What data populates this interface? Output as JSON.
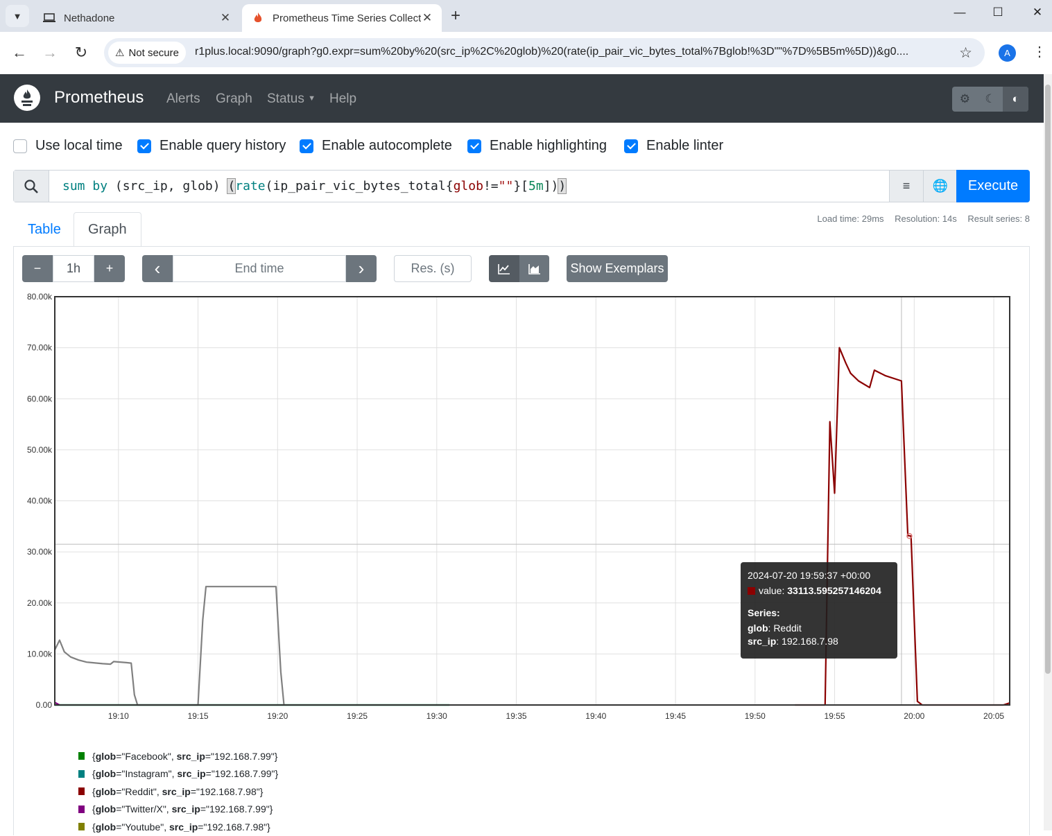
{
  "browser": {
    "tabs": [
      {
        "title": "Nethadone",
        "active": false
      },
      {
        "title": "Prometheus Time Series Collect",
        "active": true
      }
    ],
    "new_tab": "+",
    "window_controls": {
      "minimize": "—",
      "maximize": "☐",
      "close": "✕"
    },
    "security_label": "Not secure",
    "url": "r1plus.local:9090/graph?g0.expr=sum%20by%20(src_ip%2C%20glob)%20(rate(ip_pair_vic_bytes_total%7Bglob!%3D\"\"%7D%5B5m%5D))&g0....",
    "profile_initial": "A"
  },
  "navbar": {
    "brand": "Prometheus",
    "links": [
      "Alerts",
      "Graph",
      "Status",
      "Help"
    ]
  },
  "options": [
    {
      "label": "Use local time",
      "checked": false
    },
    {
      "label": "Enable query history",
      "checked": true
    },
    {
      "label": "Enable autocomplete",
      "checked": true
    },
    {
      "label": "Enable highlighting",
      "checked": true
    },
    {
      "label": "Enable linter",
      "checked": true
    }
  ],
  "query": {
    "expression": "sum by (src_ip, glob) (rate(ip_pair_vic_bytes_total{glob!=\"\"}[5m]))",
    "execute_label": "Execute"
  },
  "tabs": {
    "table": "Table",
    "graph": "Graph"
  },
  "stats": {
    "load_time": "Load time: 29ms",
    "resolution": "Resolution: 14s",
    "result_series": "Result series: 8"
  },
  "graph_controls": {
    "minus": "−",
    "range": "1h",
    "plus": "+",
    "prev": "‹",
    "end_time_placeholder": "End time",
    "next": "›",
    "resolution_placeholder": "Res. (s)",
    "show_exemplars": "Show Exemplars"
  },
  "chart_data": {
    "type": "line",
    "xlim": [
      "19:06",
      "20:06"
    ],
    "ylim": [
      0,
      80000
    ],
    "y_ticks": [
      "0.00",
      "10.00k",
      "20.00k",
      "30.00k",
      "40.00k",
      "50.00k",
      "60.00k",
      "70.00k",
      "80.00k"
    ],
    "y_tick_values": [
      0,
      10000,
      20000,
      30000,
      40000,
      50000,
      60000,
      70000,
      80000
    ],
    "x_ticks": [
      "19:10",
      "19:15",
      "19:20",
      "19:25",
      "19:30",
      "19:35",
      "19:40",
      "19:45",
      "19:50",
      "19:55",
      "20:00",
      "20:05"
    ],
    "x_tick_minutes": [
      10,
      15,
      20,
      25,
      30,
      35,
      40,
      45,
      50,
      55,
      60,
      65
    ],
    "grid": true,
    "series": [
      {
        "name": "{glob=\"Facebook\", src_ip=\"192.168.7.99\"}",
        "color": "#008000",
        "points": [
          [
            6.0,
            0
          ],
          [
            30.8,
            0
          ]
        ]
      },
      {
        "name": "{glob=\"Instagram\", src_ip=\"192.168.7.99\"}",
        "color": "#008080",
        "points": [
          [
            6.0,
            0
          ],
          [
            30.8,
            0
          ]
        ]
      },
      {
        "name": "{glob=\"Reddit\", src_ip=\"192.168.7.98\"}",
        "color": "#8b0000",
        "points": [
          [
            52.5,
            0
          ],
          [
            54.4,
            0
          ],
          [
            54.7,
            55500
          ],
          [
            55.0,
            41500
          ],
          [
            55.3,
            70000
          ],
          [
            55.7,
            67000
          ],
          [
            56.0,
            65000
          ],
          [
            56.5,
            63500
          ],
          [
            57.2,
            62200
          ],
          [
            57.5,
            65600
          ],
          [
            58.2,
            64500
          ],
          [
            59.2,
            63500
          ],
          [
            59.6,
            33200
          ],
          [
            59.8,
            33100
          ],
          [
            60.2,
            700
          ],
          [
            60.5,
            0
          ],
          [
            65.6,
            0
          ],
          [
            66.0,
            400
          ]
        ]
      },
      {
        "name": "{glob=\"Twitter/X\", src_ip=\"192.168.7.99\"}",
        "color": "#800080",
        "points": [
          [
            6.0,
            500
          ],
          [
            6.3,
            0
          ]
        ]
      },
      {
        "name": "{glob=\"Youtube\", src_ip=\"192.168.7.98\"}",
        "color": "#808000",
        "points": []
      },
      {
        "name": "grey series",
        "color": "#808080",
        "points": [
          [
            6.0,
            10800
          ],
          [
            6.3,
            12700
          ],
          [
            6.6,
            10400
          ],
          [
            7.0,
            9400
          ],
          [
            7.5,
            8800
          ],
          [
            8.0,
            8400
          ],
          [
            9.0,
            8100
          ],
          [
            9.5,
            8000
          ],
          [
            9.7,
            8500
          ],
          [
            10.5,
            8300
          ],
          [
            10.8,
            8200
          ],
          [
            11.0,
            2000
          ],
          [
            11.2,
            0
          ],
          [
            15.0,
            0
          ],
          [
            15.3,
            16700
          ],
          [
            15.5,
            23200
          ],
          [
            19.9,
            23200
          ],
          [
            20.2,
            6500
          ],
          [
            20.4,
            0
          ]
        ]
      }
    ],
    "hover_marker": {
      "x": 59.7,
      "y": 33113.6
    },
    "crosshair": {
      "x": 59.2,
      "y": 31500
    }
  },
  "tooltip": {
    "time": "2024-07-20 19:59:37 +00:00",
    "value_label": "value: ",
    "value": "33113.595257146204",
    "series_heading": "Series:",
    "labels": [
      {
        "key": "glob",
        "value": ": Reddit"
      },
      {
        "key": "src_ip",
        "value": ": 192.168.7.98"
      }
    ]
  },
  "legend": [
    {
      "glob": "Facebook",
      "src_ip": "192.168.7.99",
      "color": "#008000"
    },
    {
      "glob": "Instagram",
      "src_ip": "192.168.7.99",
      "color": "#008080"
    },
    {
      "glob": "Reddit",
      "src_ip": "192.168.7.98",
      "color": "#8b0000"
    },
    {
      "glob": "Twitter/X",
      "src_ip": "192.168.7.99",
      "color": "#800080"
    },
    {
      "glob": "Youtube",
      "src_ip": "192.168.7.98",
      "color": "#808000"
    }
  ]
}
